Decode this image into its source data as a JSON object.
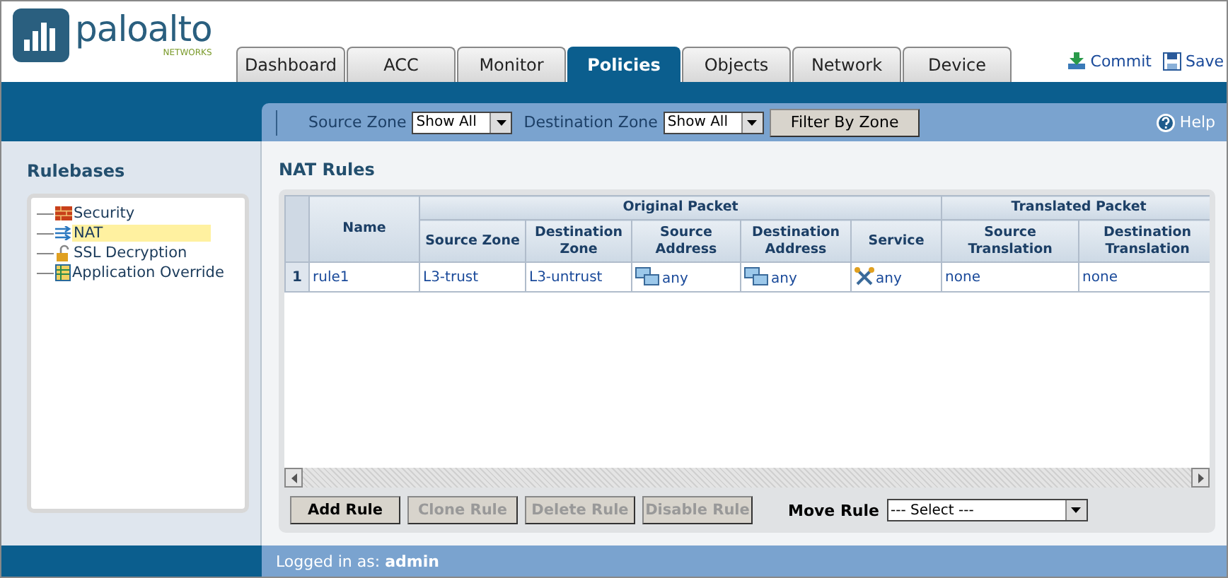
{
  "logo": {
    "name": "paloalto",
    "subtitle": "NETWORKS"
  },
  "tabs": [
    {
      "label": "Dashboard",
      "selected": false
    },
    {
      "label": "ACC",
      "selected": false
    },
    {
      "label": "Monitor",
      "selected": false
    },
    {
      "label": "Policies",
      "selected": true
    },
    {
      "label": "Objects",
      "selected": false
    },
    {
      "label": "Network",
      "selected": false
    },
    {
      "label": "Device",
      "selected": false
    }
  ],
  "header_actions": [
    {
      "kind": "commit",
      "label": "Commit"
    },
    {
      "kind": "save",
      "label": "Save"
    }
  ],
  "filter_bar": {
    "source_zone_label": "Source Zone",
    "source_zone_value": "Show All",
    "destination_zone_label": "Destination Zone",
    "destination_zone_value": "Show All",
    "filter_button": "Filter By Zone",
    "help": "Help"
  },
  "sidebar": {
    "title": "Rulebases",
    "items": [
      {
        "label": "Security",
        "kind": "security",
        "selected": false
      },
      {
        "label": "NAT",
        "kind": "nat",
        "selected": true
      },
      {
        "label": "SSL Decryption",
        "kind": "ssl",
        "selected": false
      },
      {
        "label": "Application Override",
        "kind": "override",
        "selected": false
      }
    ]
  },
  "nat_rules": {
    "title": "NAT Rules",
    "group_headers": [
      "Original Packet",
      "Translated Packet"
    ],
    "columns": [
      "Name",
      "Source Zone",
      "Destination Zone",
      "Source Address",
      "Destination Address",
      "Service",
      "Source Translation",
      "Destination Translation"
    ],
    "rows": [
      {
        "index": "1",
        "name": "rule1",
        "source_zone": "L3-trust",
        "destination_zone": "L3-untrust",
        "source_address": "any",
        "destination_address": "any",
        "service": "any",
        "source_translation": "none",
        "destination_translation": "none"
      }
    ]
  },
  "actions": [
    {
      "label": "Add Rule",
      "disabled": false
    },
    {
      "label": "Clone Rule",
      "disabled": true
    },
    {
      "label": "Delete Rule",
      "disabled": true
    },
    {
      "label": "Disable Rule",
      "disabled": true
    }
  ],
  "move_rule": {
    "label": "Move Rule",
    "value": "--- Select ---"
  },
  "status_bar": {
    "label": "Logged in as:",
    "user": "admin"
  }
}
